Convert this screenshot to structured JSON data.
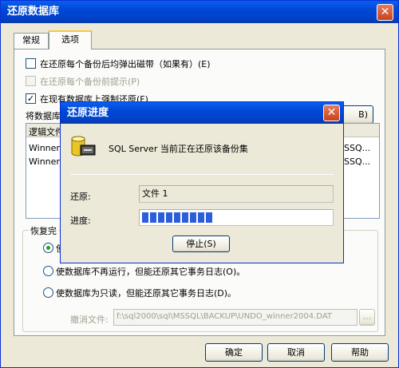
{
  "main": {
    "title": "还原数据库",
    "close_symbol": "✕",
    "tabs": [
      {
        "label": "常规",
        "active": false
      },
      {
        "label": "选项",
        "active": true
      }
    ],
    "options": [
      {
        "label": "在还原每个备份后均弹出磁带（如果有）(E)",
        "checked": false,
        "enabled": true
      },
      {
        "label": "在还原每个备份前提示(P)",
        "checked": false,
        "enabled": false
      },
      {
        "label": "在现有数据库上强制还原(F)",
        "checked": true,
        "enabled": true
      }
    ],
    "move_to_label": "将数据库",
    "browse_button_fragment": "B)",
    "table": {
      "header": [
        "逻辑文件",
        ""
      ],
      "rows": [
        [
          "Winner",
          "SSQ..."
        ],
        [
          "Winner_",
          "SSQ..."
        ]
      ]
    },
    "recovery_group_label": "恢复完",
    "recovery_options": [
      {
        "label": "使",
        "selected": true
      },
      {
        "label": "使数据库不再运行，但能还原其它事务日志(O)。",
        "selected": false
      },
      {
        "label": "使数据库为只读，但能还原其它事务日志(D)。",
        "selected": false
      }
    ],
    "undo_file_label": "撤消文件:",
    "undo_file_value": "f:\\sql2000\\sql\\MSSQL\\BACKUP\\UNDO_winner2004.DAT",
    "browse_dots": "...",
    "buttons": {
      "ok": "确定",
      "cancel": "取消",
      "help": "帮助"
    }
  },
  "progress": {
    "title": "还原进度",
    "close_symbol": "✕",
    "message": "SQL Server 当前正在还原该备份集",
    "restore_label": "还原:",
    "restore_value": "文件 1",
    "progress_label": "进度:",
    "progress_fraction": 0.39,
    "stop_button": "停止(S)",
    "icon": "database-restore-icon"
  },
  "colors": {
    "titlebar": "#0047d6",
    "progress_fill": "#2b5edc",
    "close_button": "#c9431d"
  }
}
